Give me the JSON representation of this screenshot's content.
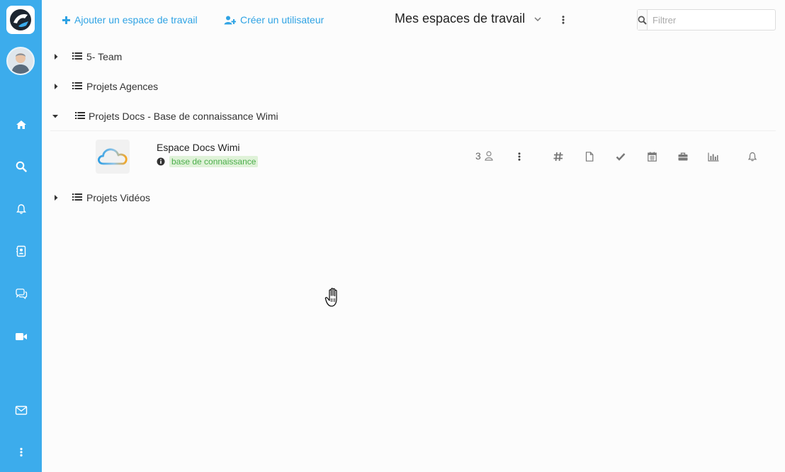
{
  "header": {
    "add_workspace_label": "Ajouter un espace de travail",
    "create_user_label": "Créer un utilisateur",
    "title": "Mes espaces de travail",
    "filter_placeholder": "Filtrer"
  },
  "tree": {
    "groups": [
      {
        "label": "5- Team",
        "expanded": false
      },
      {
        "label": "Projets Agences",
        "expanded": false
      },
      {
        "label": "Projets Docs - Base de connaissance Wimi",
        "expanded": true
      },
      {
        "label": "Projets Vidéos",
        "expanded": false
      }
    ],
    "workspace": {
      "name": "Espace Docs Wimi",
      "tag": "base de connaissance",
      "member_count": "3"
    }
  },
  "colors": {
    "sidebar": "#3cacec",
    "accent": "#2fa3e4",
    "tag_bg": "#dff2d8",
    "tag_text": "#4cae4c"
  },
  "icons": {
    "sidebar": [
      "home-icon",
      "search-icon",
      "bell-icon",
      "contacts-icon",
      "chat-icon",
      "video-icon",
      "mail-icon",
      "more-icon"
    ],
    "workspace_actions": [
      "channels-icon",
      "documents-icon",
      "tasks-icon",
      "calendar-icon",
      "projects-icon",
      "stats-icon",
      "notifications-icon"
    ]
  }
}
